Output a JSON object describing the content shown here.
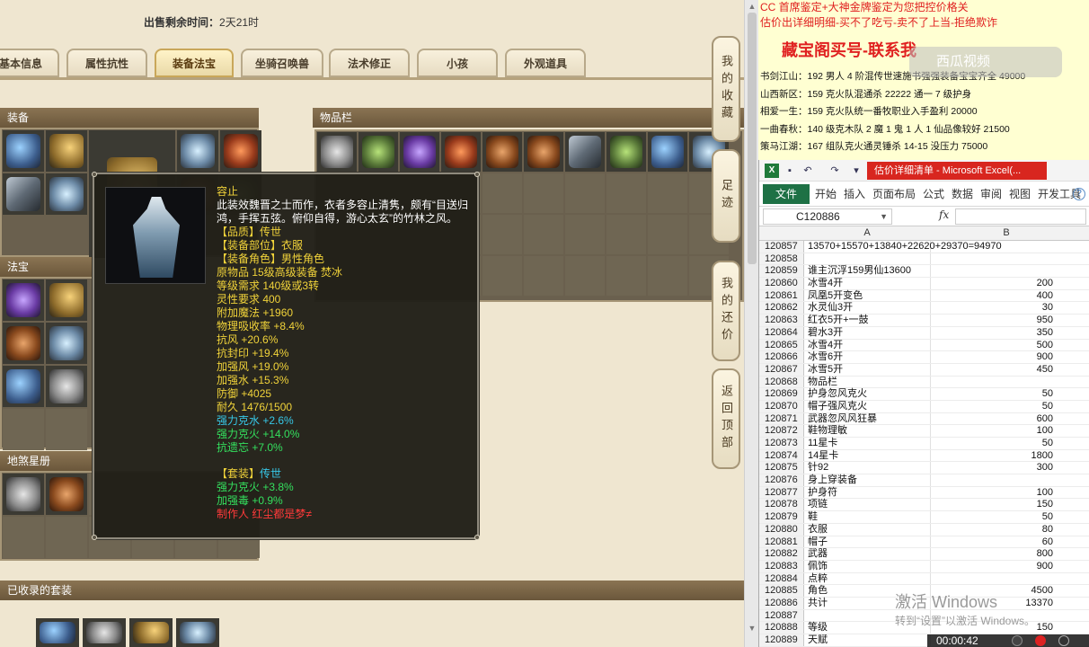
{
  "game": {
    "sale_time_label": "出售剩余时间：",
    "sale_time_value": "2天21时",
    "tabs": [
      {
        "label": "基本信息"
      },
      {
        "label": "属性抗性"
      },
      {
        "label": "装备法宝"
      },
      {
        "label": "坐骑召唤兽"
      },
      {
        "label": "法术修正"
      },
      {
        "label": "小孩"
      },
      {
        "label": "外观道具"
      }
    ],
    "sections": {
      "equipment": "装备",
      "inventory": "物品栏",
      "fabao": "法宝",
      "dishalu": "地煞星册",
      "collected_sets": "已收录的套装"
    },
    "side_buttons": [
      {
        "label": "我的收藏"
      },
      {
        "label": "足迹"
      },
      {
        "label": "我的还价"
      },
      {
        "label": "返回顶部"
      }
    ]
  },
  "tooltip": {
    "name": "容止",
    "description": "此装效魏晋之士而作，衣者多容止清隽，颇有“目送归鸿，手挥五弦。俯仰自得，游心太玄”的竹林之风。",
    "stats_yellow": [
      "【品质】传世",
      "【装备部位】衣服",
      "【装备角色】男性角色",
      "原物品 15级高级装备 焚冰",
      "等级需求 140级或3转",
      "灵性要求 400",
      "附加魔法 +1960",
      "物理吸收率 +8.4%",
      "抗风 +20.6%",
      "抗封印 +19.4%",
      "加强风 +19.0%",
      "加强水 +15.3%",
      "防御 +4025",
      "耐久 1476/1500"
    ],
    "stats_cyan": [
      "强力克水 +2.6%"
    ],
    "stats_green": [
      "强力克火 +14.0%",
      "抗遗忘 +7.0%"
    ],
    "set_label": "【套装】",
    "set_value": "传世",
    "set_stats": [
      "强力克火 +3.8%",
      "加强毒 +0.9%"
    ],
    "maker": "制作人 红尘都是梦≠"
  },
  "ad": {
    "line1": "CC 首席鉴定+大神金牌鉴定为您把控价格关",
    "line2": "估价出详细明细-买不了吃亏-卖不了上当-拒绝欺诈",
    "title": "藏宝阁买号-联系我",
    "overlay": "西瓜视频",
    "rows": [
      "书剑江山：192 男人 4 阶混传世速施书强强装备宝宝齐全 49000",
      "山西新区：159 克火队混通杀 22222 通一 7 级护身",
      "相爱一生：159 克火队统一番牧职业入手盈利 20000",
      "一曲春秋：140 级克木队 2 魔 1 鬼 1 人 1 仙品像较好 21500",
      "策马江湖：167 组队克火通灵锤杀 14-15 没压力 75000"
    ]
  },
  "excel": {
    "caption": "估价详细清单 - Microsoft Excel(...",
    "menu": [
      "文件",
      "开始",
      "插入",
      "页面布局",
      "公式",
      "数据",
      "审阅",
      "视图",
      "开发工具"
    ],
    "name_box": "C120886",
    "fx": "fx",
    "col_a": "A",
    "col_b": "B",
    "rows": [
      {
        "n": "120857",
        "a": "13570+15570+13840+22620+29370=94970",
        "b": ""
      },
      {
        "n": "120858",
        "a": "",
        "b": ""
      },
      {
        "n": "120859",
        "a": "谁主沉浮159男仙13600",
        "b": ""
      },
      {
        "n": "120860",
        "a": "冰雪4开",
        "b": "200"
      },
      {
        "n": "120861",
        "a": "凤凰5开变色",
        "b": "400"
      },
      {
        "n": "120862",
        "a": "水灵仙3开",
        "b": "30"
      },
      {
        "n": "120863",
        "a": "红衣5开+一鼓",
        "b": "950"
      },
      {
        "n": "120864",
        "a": "碧水3开",
        "b": "350"
      },
      {
        "n": "120865",
        "a": "冰雪4开",
        "b": "500"
      },
      {
        "n": "120866",
        "a": "冰雪6开",
        "b": "900"
      },
      {
        "n": "120867",
        "a": "冰雪5开",
        "b": "450"
      },
      {
        "n": "120868",
        "a": "物品栏",
        "b": ""
      },
      {
        "n": "120869",
        "a": "护身忽风克火",
        "b": "50"
      },
      {
        "n": "120870",
        "a": "帽子强风克火",
        "b": "50"
      },
      {
        "n": "120871",
        "a": "武器忽风风狂暴",
        "b": "600"
      },
      {
        "n": "120872",
        "a": "鞋物理敏",
        "b": "100"
      },
      {
        "n": "120873",
        "a": "11星卡",
        "b": "50"
      },
      {
        "n": "120874",
        "a": "14星卡",
        "b": "1800"
      },
      {
        "n": "120875",
        "a": "针92",
        "b": "300"
      },
      {
        "n": "120876",
        "a": "身上穿装备",
        "b": ""
      },
      {
        "n": "120877",
        "a": "护身符",
        "b": "100"
      },
      {
        "n": "120878",
        "a": "项链",
        "b": "150"
      },
      {
        "n": "120879",
        "a": "鞋",
        "b": "50"
      },
      {
        "n": "120880",
        "a": "衣服",
        "b": "80"
      },
      {
        "n": "120881",
        "a": "帽子",
        "b": "60"
      },
      {
        "n": "120882",
        "a": "武器",
        "b": "800"
      },
      {
        "n": "120883",
        "a": "佩饰",
        "b": "900"
      },
      {
        "n": "120884",
        "a": "点粹",
        "b": ""
      },
      {
        "n": "120885",
        "a": "角色",
        "b": "4500"
      },
      {
        "n": "120886",
        "a": "共计",
        "b": "13370"
      },
      {
        "n": "120887",
        "a": "",
        "b": ""
      },
      {
        "n": "120888",
        "a": "等级",
        "b": "150"
      },
      {
        "n": "120889",
        "a": "天赋",
        "b": ""
      }
    ]
  },
  "watermark": {
    "line1": "激活 Windows",
    "line2": "转到“设置”以激活 Windows。"
  },
  "recorder": {
    "time": "00:00:42"
  }
}
